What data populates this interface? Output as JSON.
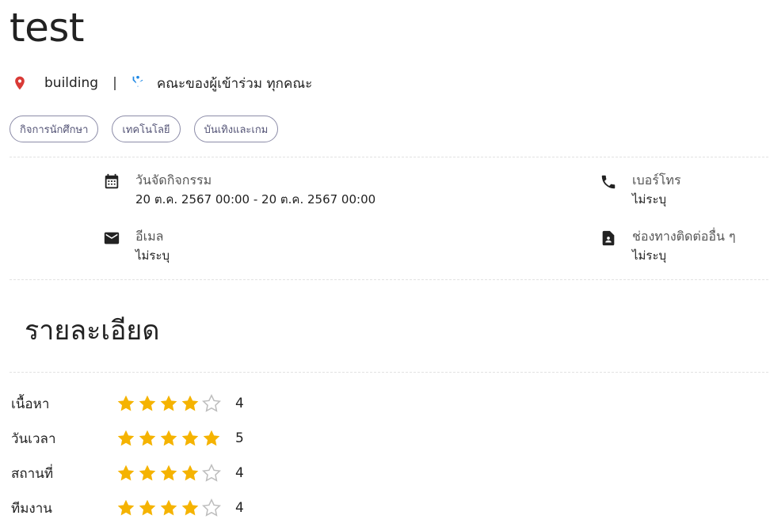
{
  "event": {
    "title": "test",
    "location": "building",
    "separator": "|",
    "audience": "คณะของผู้เข้าร่วม ทุกคณะ",
    "tags": [
      "กิจการนักศึกษา",
      "เทคโนโลยี",
      "บันเทิงและเกม"
    ]
  },
  "info": {
    "date_label": "วันจัดกิจกรรม",
    "date_value": "20 ต.ค. 2567 00:00 - 20 ต.ค. 2567 00:00",
    "phone_label": "เบอร์โทร",
    "phone_value": "ไม่ระบุ",
    "email_label": "อีเมล",
    "email_value": "ไม่ระบุ",
    "other_label": "ช่องทางติดต่ออื่น ๆ",
    "other_value": "ไม่ระบุ"
  },
  "details": {
    "title": "รายละเอียด"
  },
  "ratings": [
    {
      "label": "เนื้อหา",
      "value": 4,
      "max": 5,
      "display": "4"
    },
    {
      "label": "วันเวลา",
      "value": 5,
      "max": 5,
      "display": "5"
    },
    {
      "label": "สถานที่",
      "value": 4,
      "max": 5,
      "display": "4"
    },
    {
      "label": "ทีมงาน",
      "value": 4,
      "max": 5,
      "display": "4"
    }
  ],
  "colors": {
    "star_filled": "#F5B301",
    "star_empty": "#BDBDBD",
    "pin": "#D93A36",
    "person": "#1E88E5",
    "chip_border": "#8C8CA8",
    "chip_text": "#555577"
  },
  "icons": {
    "location": "location-pin-icon",
    "audience": "person-icon",
    "date": "calendar-icon",
    "phone": "phone-icon",
    "email": "mail-icon",
    "other": "contact-card-icon",
    "star": "star-icon"
  }
}
